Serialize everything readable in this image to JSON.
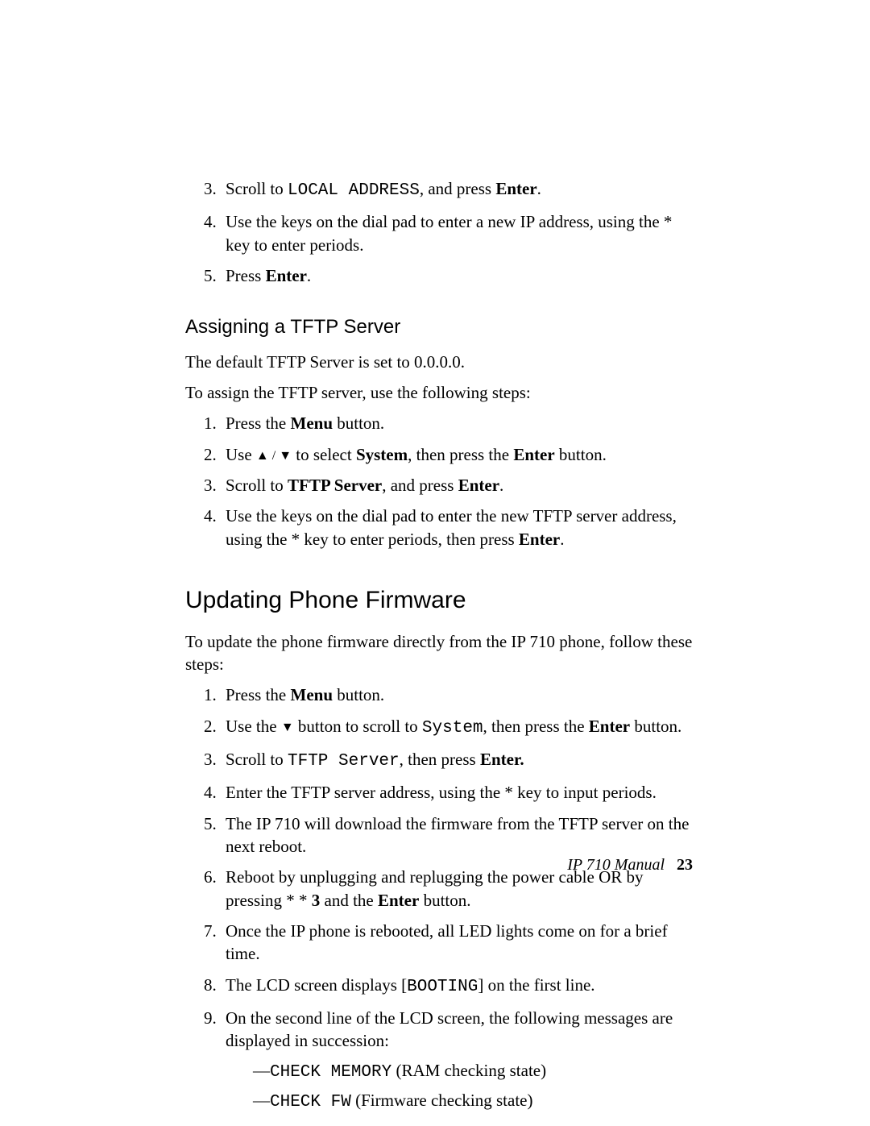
{
  "topSteps": {
    "start": 3,
    "items": [
      {
        "pre": "Scroll to ",
        "mono": "LOCAL ADDRESS",
        "mid": ", and press ",
        "bold": "Enter",
        "post": "."
      },
      {
        "plain": "Use the keys on the dial pad to enter a new IP address, using the * key to enter periods."
      },
      {
        "pre": "Press ",
        "bold": "Enter",
        "post": "."
      }
    ]
  },
  "tftpHeading": "Assigning a TFTP Server",
  "tftpPara1": "The default TFTP Server is set to 0.0.0.0.",
  "tftpPara2": "To assign the TFTP server, use the following steps:",
  "tftpSteps": [
    {
      "pre": "Press the ",
      "bold": "Menu",
      "post": " button."
    },
    {
      "pre": "Use ",
      "arrows": "▲ / ▼",
      "mid": " to select ",
      "bold1": "System",
      "mid2": ", then press the ",
      "bold2": "Enter",
      "post": " button."
    },
    {
      "pre": "Scroll to ",
      "bold1": "TFTP Server",
      "mid": ", and press ",
      "bold2": "Enter",
      "post": "."
    },
    {
      "pre": "Use the keys on the dial pad to enter the new TFTP server address, using the * key to enter periods, then press ",
      "bold": "Enter",
      "post": "."
    }
  ],
  "fwHeading": "Updating Phone Firmware",
  "fwPara": "To update the phone firmware directly from the IP 710 phone, follow these steps:",
  "fwSteps": [
    {
      "pre": "Press the ",
      "bold": "Menu",
      "post": " button."
    },
    {
      "pre": "Use the ",
      "arrow": "▼",
      "mid": " button to scroll to ",
      "mono": "System",
      "mid2": ", then press the ",
      "bold": "Enter",
      "post": " button."
    },
    {
      "pre": "Scroll to ",
      "mono": "TFTP Server",
      "mid": ", then press ",
      "bold": "Enter.",
      "post": ""
    },
    {
      "plain": "Enter the TFTP server address, using the * key to input periods."
    },
    {
      "plain": "The IP 710 will download the firmware from the TFTP server on the next reboot."
    },
    {
      "pre": "Reboot by unplugging and replugging the power cable OR by pressing * * ",
      "bold1": "3",
      "mid": " and the ",
      "bold2": "Enter",
      "post": " button."
    },
    {
      "plain": "Once the IP phone is rebooted, all LED lights come on for a brief time."
    },
    {
      "pre": "The LCD screen displays [",
      "mono": "BOOTING",
      "post": "] on the first line."
    },
    {
      "plain": "On the second line of the LCD screen, the following messages are displayed in succession:",
      "subs": [
        {
          "dash": "—",
          "mono": "CHECK MEMORY",
          "rest": " (RAM checking state)"
        },
        {
          "dash": "—",
          "mono": "CHECK FW",
          "rest": " (Firmware checking state)"
        }
      ]
    }
  ],
  "footer": {
    "manual": "IP 710 Manual",
    "page": "23"
  }
}
